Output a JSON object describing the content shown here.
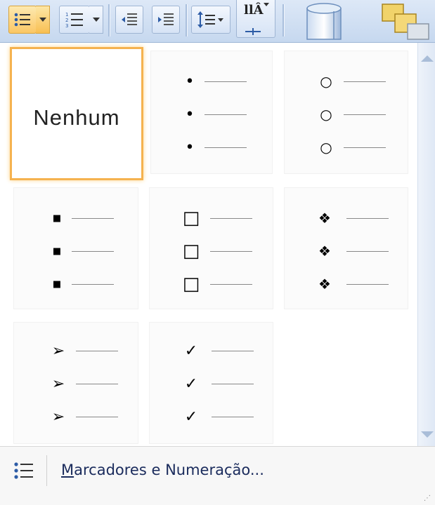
{
  "toolbar": {
    "items": [
      {
        "name": "bullets-button",
        "icon": "bulleted-list-icon",
        "active": true
      },
      {
        "name": "bullets-dropdown",
        "icon": "chevron-down-icon",
        "active": true
      },
      {
        "name": "numbering-button",
        "icon": "numbered-list-icon"
      },
      {
        "name": "numbering-dropdown",
        "icon": "chevron-down-icon"
      },
      {
        "name": "decrease-indent-button",
        "icon": "decrease-indent-icon"
      },
      {
        "name": "increase-indent-button",
        "icon": "increase-indent-icon"
      },
      {
        "name": "line-spacing-button",
        "icon": "line-spacing-icon"
      },
      {
        "name": "text-direction-button",
        "icon": "text-direction-icon"
      },
      {
        "name": "shape-button",
        "icon": "cylinder-shape-icon"
      },
      {
        "name": "arrange-button",
        "icon": "arrange-icon"
      }
    ]
  },
  "gallery": {
    "none_label": "Nenhum",
    "styles": [
      {
        "name": "none",
        "bullet": "",
        "selected": true
      },
      {
        "name": "filled-round",
        "bullet": "•"
      },
      {
        "name": "hollow-round",
        "bullet": "○"
      },
      {
        "name": "filled-square",
        "bullet": "■"
      },
      {
        "name": "hollow-square",
        "bullet": "□"
      },
      {
        "name": "four-diamond",
        "bullet": "❖"
      },
      {
        "name": "arrowhead",
        "bullet": "➢"
      },
      {
        "name": "checkmark",
        "bullet": "✓"
      }
    ]
  },
  "footer": {
    "icon": "bulleted-list-icon",
    "label_mnemonic": "M",
    "label_rest": "arcadores e Numeração..."
  },
  "colors": {
    "selection_border": "#f5b24f",
    "ribbon_top": "#dde8f7",
    "footer_text": "#1a2b5c"
  }
}
